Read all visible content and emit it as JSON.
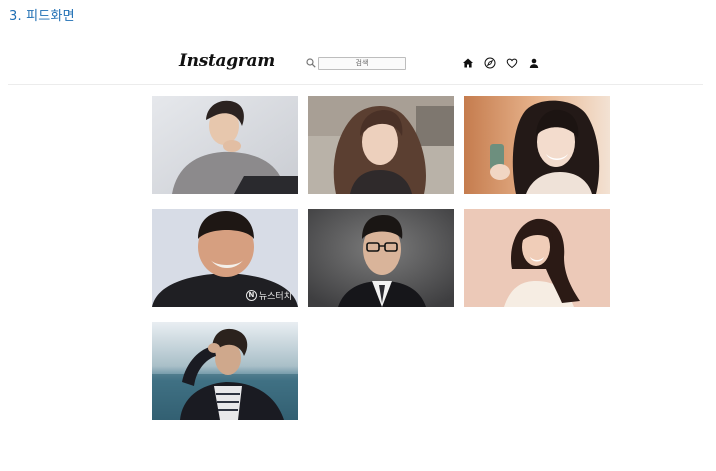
{
  "section_heading": "3. 피드화면",
  "header": {
    "logo_text": "Instagram",
    "search_placeholder": "검색",
    "nav_icons": [
      "home-icon",
      "explore-icon",
      "heart-icon",
      "profile-icon"
    ]
  },
  "feed": {
    "photos": [
      {
        "description": "man-gray-sweater-portrait"
      },
      {
        "description": "woman-long-wavy-hair-selfie"
      },
      {
        "description": "woman-smiling-holding-product"
      },
      {
        "description": "man-black-tshirt-smiling",
        "watermark": "뉴스터치",
        "watermark_badge": "N"
      },
      {
        "description": "man-glasses-suit-portrait"
      },
      {
        "description": "woman-cream-blouse-portrait"
      },
      {
        "description": "man-dark-jacket-outdoor"
      }
    ]
  },
  "colors": {
    "heading_blue": "#1f6fb4",
    "divider": "#ececec"
  }
}
